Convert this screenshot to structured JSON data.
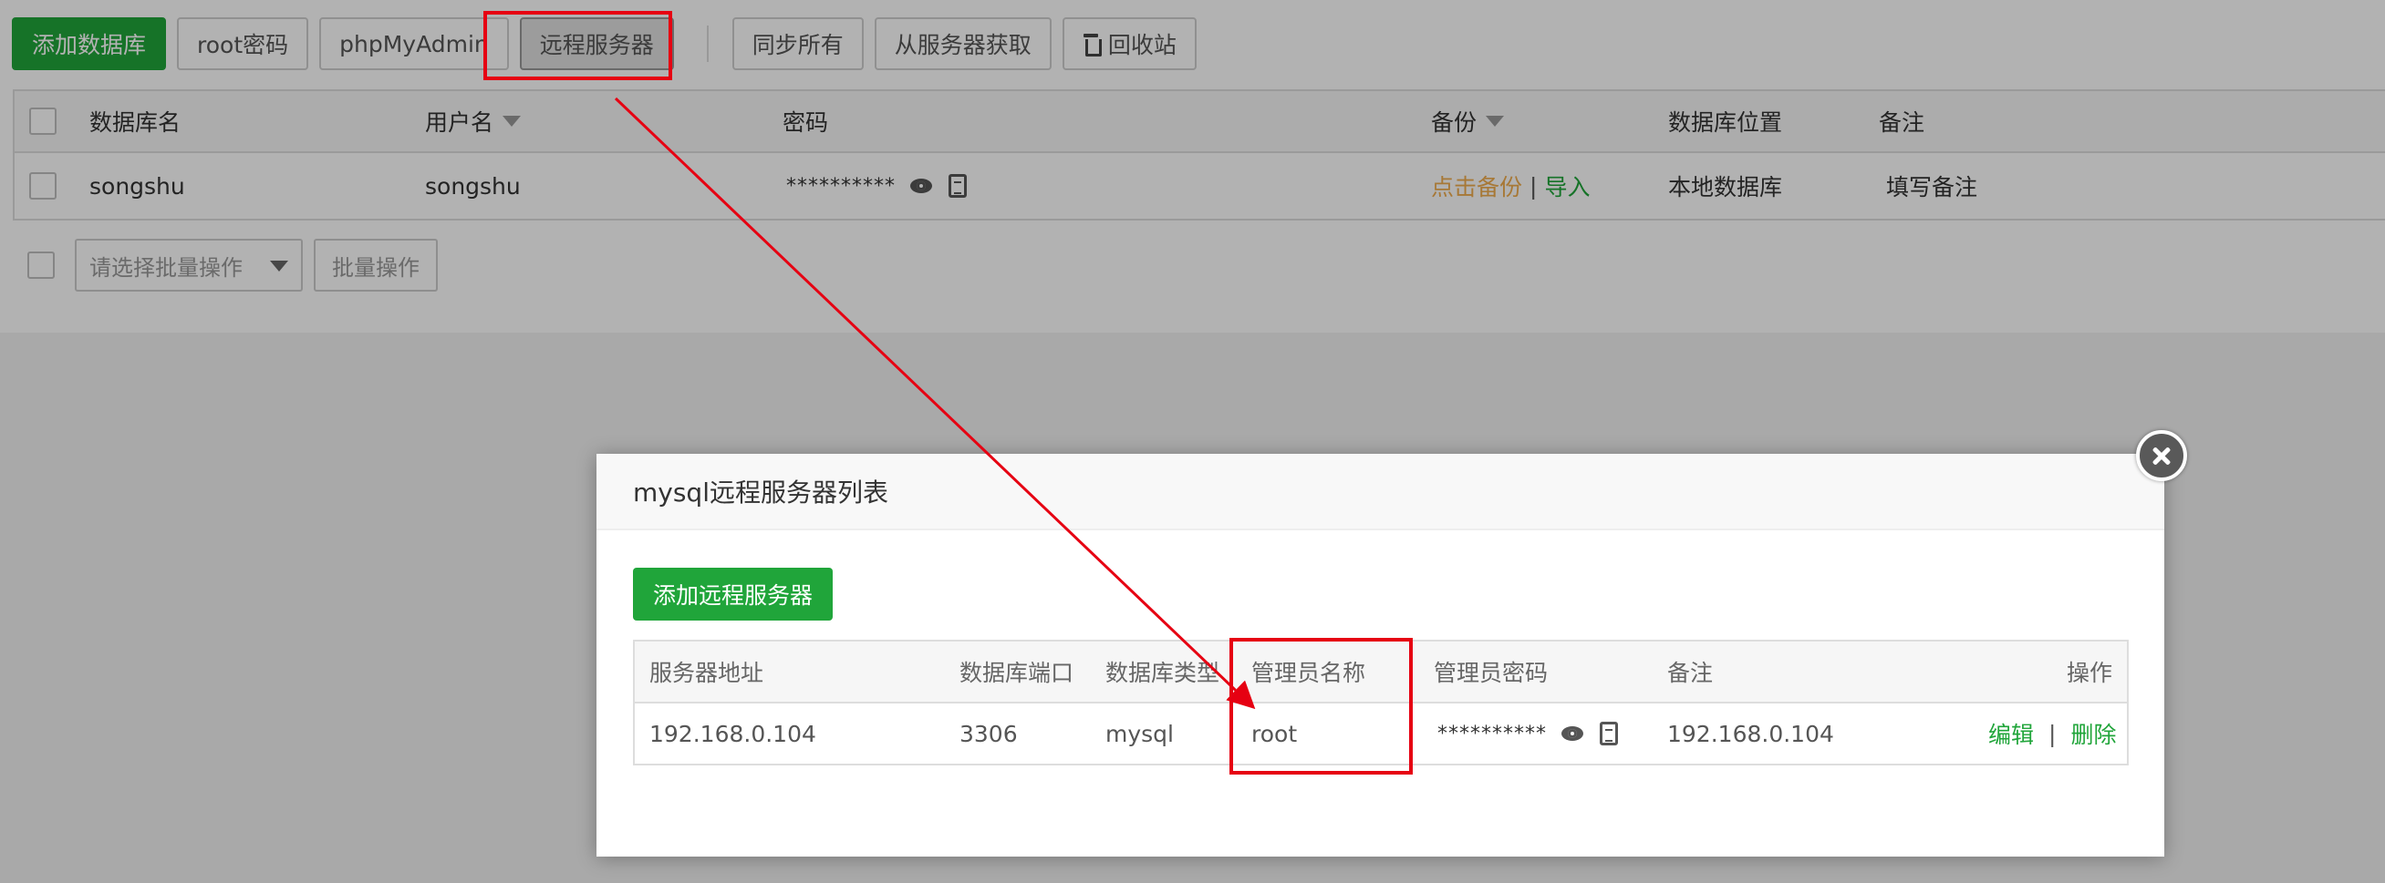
{
  "toolbar": {
    "add_db": "添加数据库",
    "root_pwd": "root密码",
    "phpmyadmin": "phpMyAdmin",
    "remote_server": "远程服务器",
    "sync_all": "同步所有",
    "fetch_from_server": "从服务器获取",
    "recycle_bin": "回收站"
  },
  "db_table": {
    "headers": {
      "name": "数据库名",
      "user": "用户名",
      "password": "密码",
      "backup": "备份",
      "location": "数据库位置",
      "note": "备注"
    },
    "rows": [
      {
        "name": "songshu",
        "user": "songshu",
        "password_mask": "**********",
        "backup_link": "点击备份",
        "backup_sep": "|",
        "import_link": "导入",
        "location": "本地数据库",
        "note": "填写备注"
      }
    ]
  },
  "batch": {
    "select_placeholder": "请选择批量操作",
    "button": "批量操作"
  },
  "modal": {
    "title": "mysql远程服务器列表",
    "add_button": "添加远程服务器",
    "headers": {
      "address": "服务器地址",
      "port": "数据库端口",
      "type": "数据库类型",
      "admin_name": "管理员名称",
      "admin_password": "管理员密码",
      "note": "备注",
      "action": "操作"
    },
    "rows": [
      {
        "address": "192.168.0.104",
        "port": "3306",
        "type": "mysql",
        "admin_name": "root",
        "admin_password_mask": "**********",
        "note": "192.168.0.104",
        "edit": "编辑",
        "sep": "|",
        "delete": "删除"
      }
    ]
  },
  "colors": {
    "accent_green": "#20a53a",
    "backup_orange": "#f0ad4e",
    "annotation_red": "#e60012"
  }
}
